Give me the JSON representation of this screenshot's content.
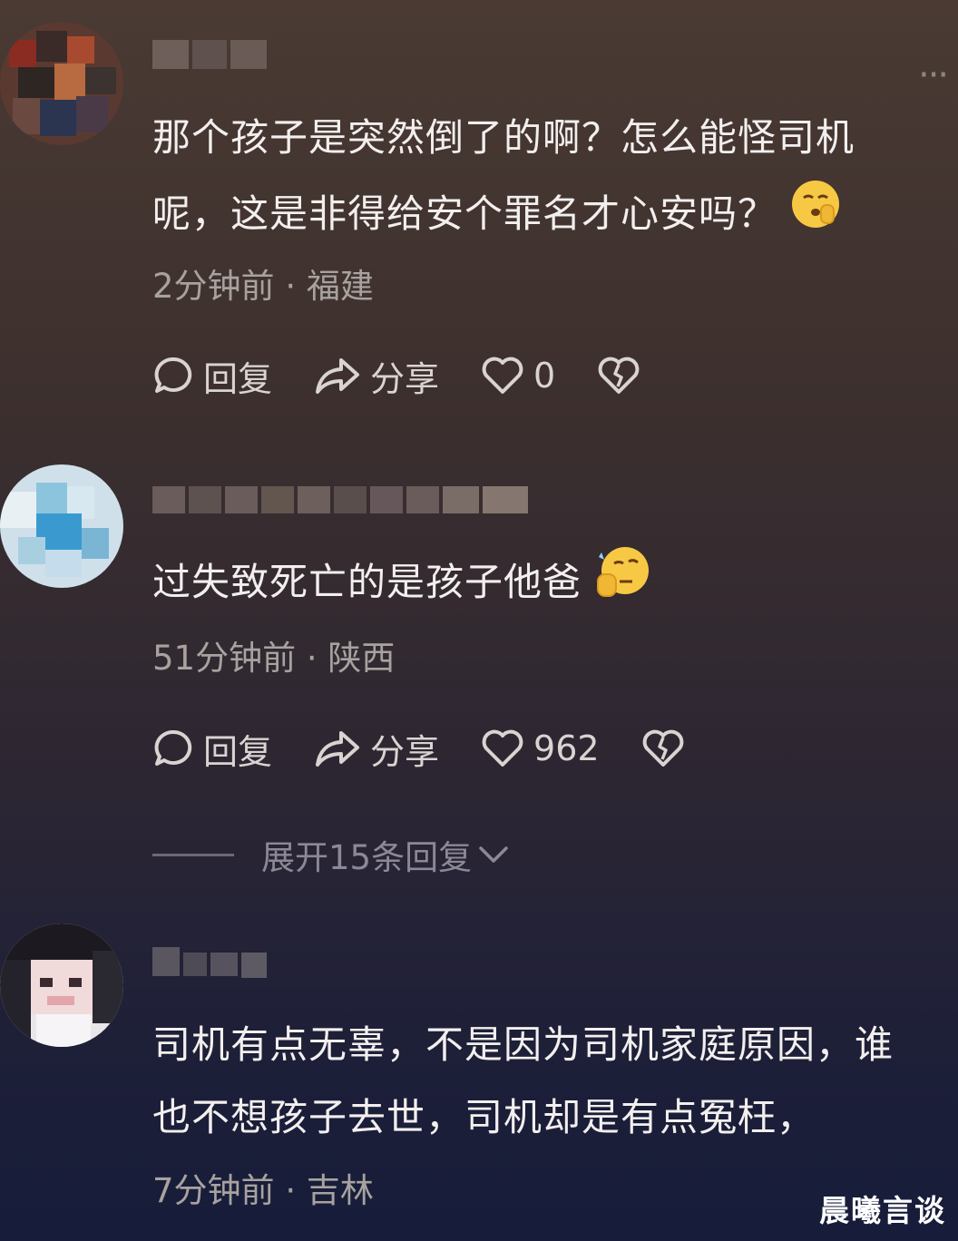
{
  "comments": [
    {
      "text_lines": [
        "那个孩子是突然倒了的啊？怎么能怪司机",
        "呢，这是非得给安个罪名才心安吗？"
      ],
      "emoji": "shushing-face-emoji",
      "time": "2分钟前",
      "location": "福建",
      "actions": {
        "reply": "回复",
        "share": "分享",
        "likes": "0"
      }
    },
    {
      "text_lines": [
        "过失致死亡的是孩子他爸"
      ],
      "emoji": "thinking-face-emoji",
      "time": "51分钟前",
      "location": "陕西",
      "actions": {
        "reply": "回复",
        "share": "分享",
        "likes": "962"
      }
    },
    {
      "text_lines": [
        "司机有点无辜，不是因为司机家庭原因，谁",
        "也不想孩子去世，司机却是有点冤枉，"
      ],
      "time": "7分钟前",
      "location": "吉林"
    }
  ],
  "expand_replies": "展开15条回复",
  "separator": "·",
  "more_menu": "···",
  "watermark": "晨曦言谈",
  "colors": {
    "text": "#f2efee",
    "meta": "#a8a29f",
    "bg_top": "#4a3a33",
    "bg_bottom": "#161c3a"
  }
}
